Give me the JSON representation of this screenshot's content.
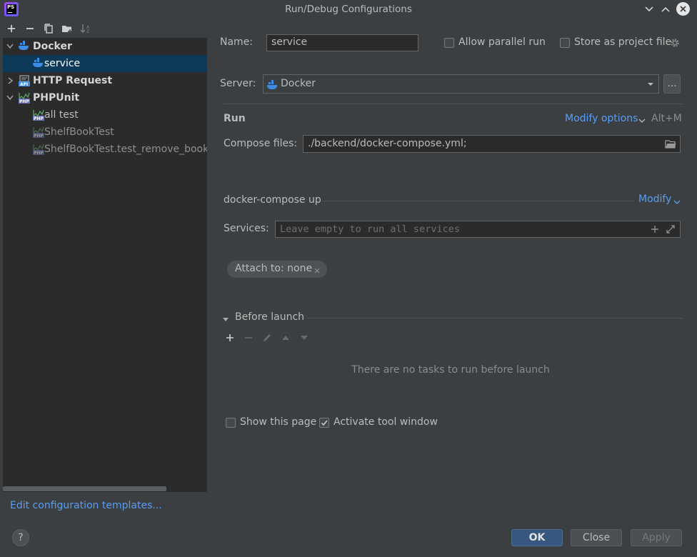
{
  "window": {
    "title": "Run/Debug Configurations",
    "app_icon_text": "PS"
  },
  "tree": {
    "docker": {
      "label": "Docker",
      "child": "service"
    },
    "http": {
      "label": "HTTP Request"
    },
    "phpunit": {
      "label": "PHPUnit",
      "children": [
        "all test",
        "ShelfBookTest",
        "ShelfBookTest.test_remove_book_f"
      ]
    }
  },
  "form": {
    "name_label": "Name:",
    "name_value": "service",
    "allow_parallel": "Allow parallel run",
    "store_as_file": "Store as project file",
    "server_label": "Server:",
    "server_value": "Docker",
    "server_more": "...",
    "run_title": "Run",
    "modify_options": "Modify options",
    "modify_shortcut": "Alt+M",
    "compose_label": "Compose files:",
    "compose_value": "./backend/docker-compose.yml;",
    "compose_up_title": "docker-compose up",
    "modify": "Modify",
    "services_label": "Services:",
    "services_placeholder": "Leave empty to run all services",
    "attach_chip": "Attach to: none",
    "before_launch": "Before launch",
    "no_tasks": "There are no tasks to run before launch",
    "show_page": "Show this page",
    "activate_tool": "Activate tool window"
  },
  "footer": {
    "edit_templates": "Edit configuration templates...",
    "help": "?",
    "ok": "OK",
    "close": "Close",
    "apply": "Apply"
  },
  "colors": {
    "accent": "#589df6",
    "selection": "#0d3a58",
    "docker_blue": "#3d8be2"
  }
}
